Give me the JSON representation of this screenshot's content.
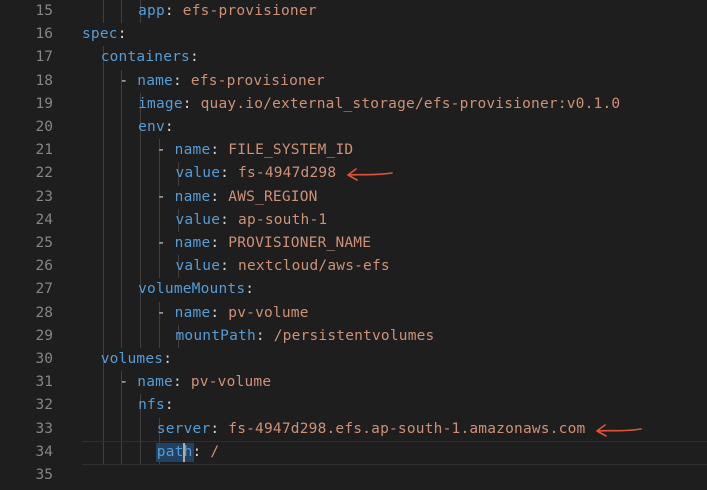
{
  "editor": {
    "lines": [
      {
        "num": "15",
        "indent": 4,
        "key": "app",
        "value": "efs-provisioner"
      },
      {
        "num": "16",
        "indent": 1,
        "key": "spec",
        "value": ""
      },
      {
        "num": "17",
        "indent": 2,
        "key": "containers",
        "value": ""
      },
      {
        "num": "18",
        "indent": 3,
        "dash": "- ",
        "key": "name",
        "value": "efs-provisioner"
      },
      {
        "num": "19",
        "indent": 4,
        "key": "image",
        "value": "quay.io/external_storage/efs-provisioner:v0.1.0"
      },
      {
        "num": "20",
        "indent": 4,
        "key": "env",
        "value": ""
      },
      {
        "num": "21",
        "indent": 5,
        "dash": "- ",
        "key": "name",
        "value": "FILE_SYSTEM_ID"
      },
      {
        "num": "22",
        "indent": 6,
        "key": "value",
        "value": "fs-4947d298",
        "arrow": true
      },
      {
        "num": "23",
        "indent": 5,
        "dash": "- ",
        "key": "name",
        "value": "AWS_REGION"
      },
      {
        "num": "24",
        "indent": 6,
        "key": "value",
        "value": "ap-south-1"
      },
      {
        "num": "25",
        "indent": 5,
        "dash": "- ",
        "key": "name",
        "value": "PROVISIONER_NAME"
      },
      {
        "num": "26",
        "indent": 6,
        "key": "value",
        "value": "nextcloud/aws-efs"
      },
      {
        "num": "27",
        "indent": 4,
        "key": "volumeMounts",
        "value": ""
      },
      {
        "num": "28",
        "indent": 5,
        "dash": "- ",
        "key": "name",
        "value": "pv-volume"
      },
      {
        "num": "29",
        "indent": 6,
        "key": "mountPath",
        "value": "/persistentvolumes"
      },
      {
        "num": "30",
        "indent": 2,
        "key": "volumes",
        "value": ""
      },
      {
        "num": "31",
        "indent": 3,
        "dash": "- ",
        "key": "name",
        "value": "pv-volume"
      },
      {
        "num": "32",
        "indent": 4,
        "key": "nfs",
        "value": ""
      },
      {
        "num": "33",
        "indent": 5,
        "key": "server",
        "value": "fs-4947d298.efs.ap-south-1.amazonaws.com",
        "arrow": true
      },
      {
        "num": "34",
        "indent": 5,
        "key": "path",
        "value": "/",
        "current": true
      },
      {
        "num": "35",
        "indent": 0,
        "key": "",
        "value": ""
      }
    ]
  },
  "colors": {
    "background": "#1e1e1e",
    "key": "#569cd6",
    "value": "#ce9178",
    "line_number": "#858585",
    "annotation_arrow": "#e0533a"
  },
  "icons": {
    "annotation": "hand-drawn-arrow-icon"
  }
}
